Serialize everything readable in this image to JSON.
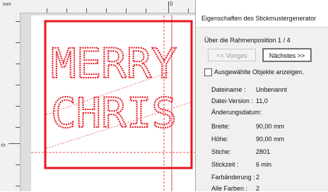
{
  "ruler": {
    "unit": "mm",
    "top_label_zero": "0",
    "left_label_zero": "0"
  },
  "panel": {
    "title": "Eigenschaften des Stickmustergenerator",
    "frame_position": "Über die Rahmenposition 1 / 4",
    "prev_button": "<< Voriges",
    "next_button": "Nächstes >>",
    "show_selected_label": "Ausgewählte Objekte anzeigen.",
    "show_selected_checked": false,
    "properties": [
      {
        "label": "Dateiname :",
        "value": "Unbenannt"
      },
      {
        "label": "Datei-Version :",
        "value": "11,0"
      },
      {
        "label": "Änderungsdatum:",
        "value": ""
      },
      {
        "label": "Breite:",
        "value": "90,00 mm"
      },
      {
        "label": "Höhe:",
        "value": "90,00 mm"
      },
      {
        "label": "Stiche:",
        "value": "2801"
      },
      {
        "label": "Stickzeit :",
        "value": "6 min"
      },
      {
        "label": "Farbänderung :",
        "value": "2"
      },
      {
        "label": "Alle Farben :",
        "value": "2"
      }
    ]
  },
  "canvas": {
    "line1": "MERRY",
    "line2": "CHRIS",
    "frame_color": "#e8161d",
    "embroidery_color": "#e8161d"
  }
}
